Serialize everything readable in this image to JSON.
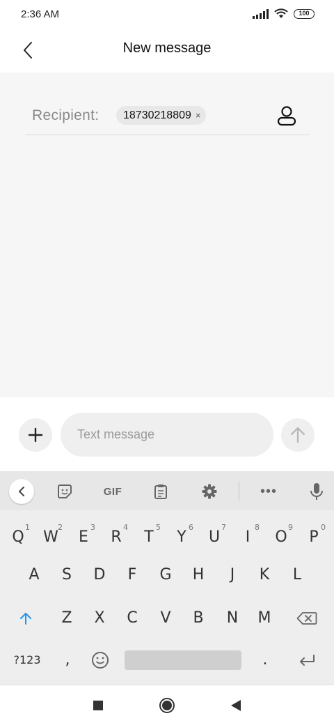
{
  "status_bar": {
    "time": "2:36 AM",
    "battery": "100"
  },
  "header": {
    "title": "New message"
  },
  "recipient": {
    "label": "Recipient:",
    "chip_number": "18730218809",
    "chip_remove": "×"
  },
  "compose": {
    "placeholder": "Text message"
  },
  "keyboard": {
    "toolbar": {
      "gif": "GIF",
      "more": "•••"
    },
    "row1": [
      {
        "key": "Q",
        "hint": "1"
      },
      {
        "key": "W",
        "hint": "2"
      },
      {
        "key": "E",
        "hint": "3"
      },
      {
        "key": "R",
        "hint": "4"
      },
      {
        "key": "T",
        "hint": "5"
      },
      {
        "key": "Y",
        "hint": "6"
      },
      {
        "key": "U",
        "hint": "7"
      },
      {
        "key": "I",
        "hint": "8"
      },
      {
        "key": "O",
        "hint": "9"
      },
      {
        "key": "P",
        "hint": "0"
      }
    ],
    "row2": [
      "A",
      "S",
      "D",
      "F",
      "G",
      "H",
      "J",
      "K",
      "L"
    ],
    "row3": [
      "Z",
      "X",
      "C",
      "V",
      "B",
      "N",
      "M"
    ],
    "row4": {
      "symbols": "?123",
      "comma": ",",
      "period": "."
    }
  },
  "colors": {
    "shift_active": "#2196f3",
    "content_bg": "#f6f6f6",
    "keyboard_bg": "#eeeeee"
  }
}
